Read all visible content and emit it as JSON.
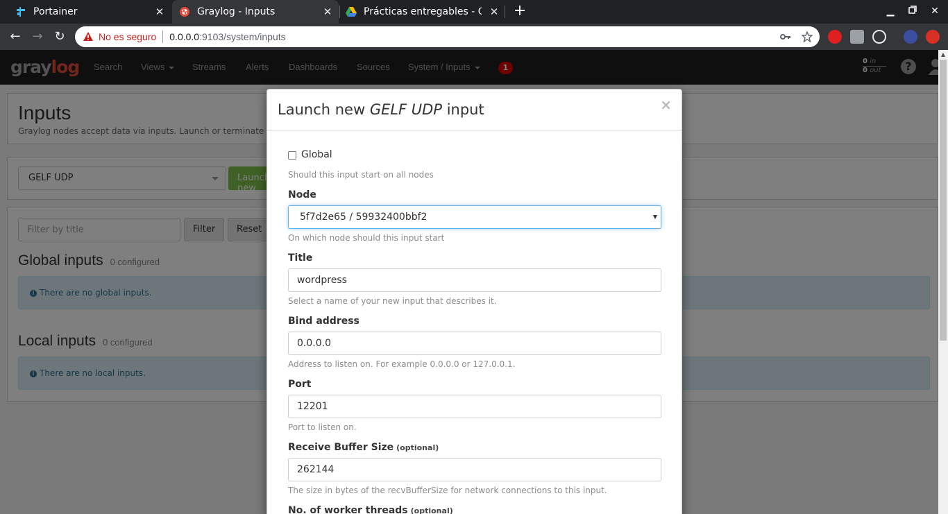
{
  "browser": {
    "tabs": [
      {
        "title": "Portainer",
        "active": false
      },
      {
        "title": "Graylog - Inputs",
        "active": true
      },
      {
        "title": "Prácticas entregables - Go",
        "active": false
      }
    ],
    "url": {
      "security_label": "No es seguro",
      "host": "0.0.0.0",
      "path": ":9103/system/inputs"
    }
  },
  "graylog_nav": {
    "logo_gray": "gray",
    "logo_red": "log",
    "links": [
      "Search",
      "Views",
      "Streams",
      "Alerts",
      "Dashboards",
      "Sources",
      "System / Inputs"
    ],
    "notification_count": "1",
    "throughput_in": "0",
    "throughput_in_label": "in",
    "throughput_out": "0",
    "throughput_out_label": "out"
  },
  "page": {
    "title": "Inputs",
    "description": "Graylog nodes accept data via inputs. Launch or terminate as ma",
    "input_type_selected": "GELF UDP",
    "launch_button": "Launch new input",
    "filter_placeholder": "Filter by title",
    "filter_button": "Filter",
    "reset_button": "Reset",
    "global_inputs": {
      "title": "Global inputs",
      "count": "0 configured",
      "empty_message": "There are no global inputs."
    },
    "local_inputs": {
      "title": "Local inputs",
      "count": "0 configured",
      "empty_message": "There are no local inputs."
    }
  },
  "modal": {
    "title_prefix": "Launch new ",
    "title_type": "GELF UDP",
    "title_suffix": " input",
    "close": "×",
    "global": {
      "label": "Global",
      "checked": false,
      "help": "Should this input start on all nodes"
    },
    "node": {
      "label": "Node",
      "value": "5f7d2e65 / 59932400bbf2",
      "help": "On which node should this input start"
    },
    "title_field": {
      "label": "Title",
      "value": "wordpress",
      "help": "Select a name of your new input that describes it."
    },
    "bind_address": {
      "label": "Bind address",
      "value": "0.0.0.0",
      "help": "Address to listen on. For example 0.0.0.0 or 127.0.0.1."
    },
    "port": {
      "label": "Port",
      "value": "12201",
      "help": "Port to listen on."
    },
    "receive_buffer": {
      "label": "Receive Buffer Size",
      "optional": "(optional)",
      "value": "262144",
      "help": "The size in bytes of the recvBufferSize for network connections to this input."
    },
    "worker_threads": {
      "label": "No. of worker threads",
      "optional": "(optional)"
    }
  },
  "colors": {
    "graylog_red": "#e24c38",
    "navbar_bg": "#1f1f1f",
    "launch_green": "#7fc24a",
    "focus_blue": "#66afe9",
    "info_bg": "#d9edf7"
  }
}
